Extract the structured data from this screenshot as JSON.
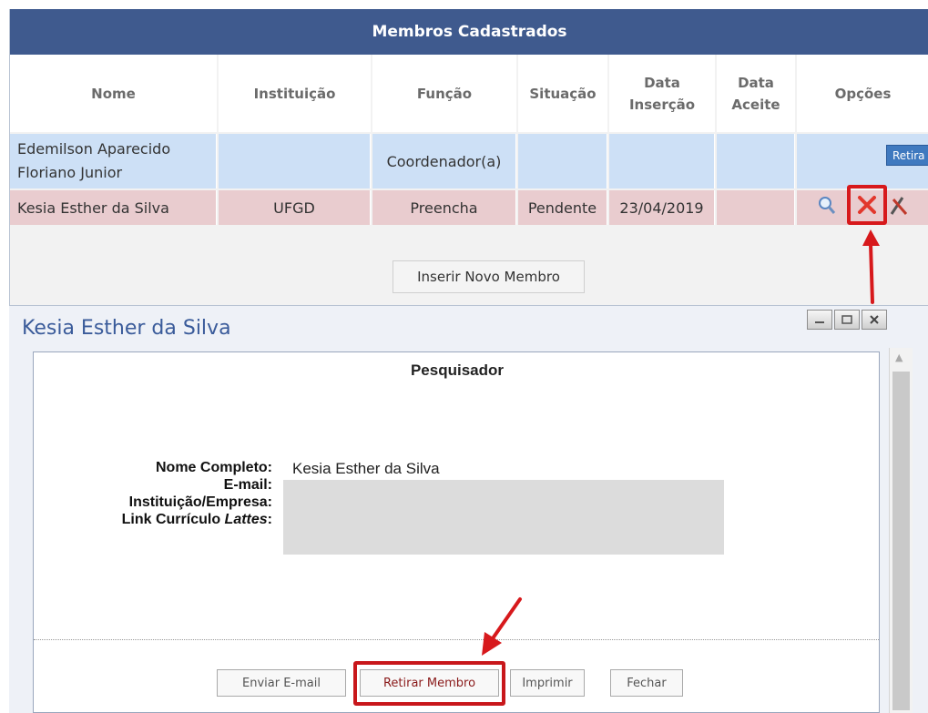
{
  "table": {
    "title": "Membros Cadastrados",
    "headers": {
      "nome": "Nome",
      "instituicao": "Instituição",
      "funcao": "Função",
      "situacao": "Situação",
      "data_insercao_1": "Data",
      "data_insercao_2": "Inserção",
      "data_aceite_1": "Data",
      "data_aceite_2": "Aceite",
      "opcoes": "Opções"
    },
    "rows": [
      {
        "nome_1": "Edemilson Aparecido",
        "nome_2": "Floriano Junior",
        "instituicao": "",
        "funcao": "Coordenador(a)",
        "situacao": "",
        "data_insercao": "",
        "data_aceite": "",
        "option_label": "Retira"
      },
      {
        "nome": "Kesia Esther da Silva",
        "instituicao": "UFGD",
        "funcao": "Preencha",
        "situacao": "Pendente",
        "data_insercao": "23/04/2019",
        "data_aceite": ""
      }
    ],
    "insert_button": "Inserir Novo Membro"
  },
  "modal": {
    "title": "Kesia Esther da Silva",
    "section_heading": "Pesquisador",
    "labels": {
      "nome_completo": "Nome Completo:",
      "email": "E-mail:",
      "instituicao": "Instituição/Empresa:",
      "lattes_prefix": "Link Currículo ",
      "lattes_italic": "Lattes",
      "lattes_suffix": ":"
    },
    "values": {
      "nome_completo": "Kesia Esther da Silva"
    },
    "buttons": {
      "email": "Enviar E-mail",
      "retirar": "Retirar Membro",
      "imprimir": "Imprimir",
      "fechar": "Fechar"
    }
  },
  "colors": {
    "header_bar": "#3f5a8e",
    "row_coordinator": "#cde0f6",
    "row_pending": "#e9cccf",
    "highlight": "#d7191c",
    "modal_title": "#3a5b9a"
  }
}
